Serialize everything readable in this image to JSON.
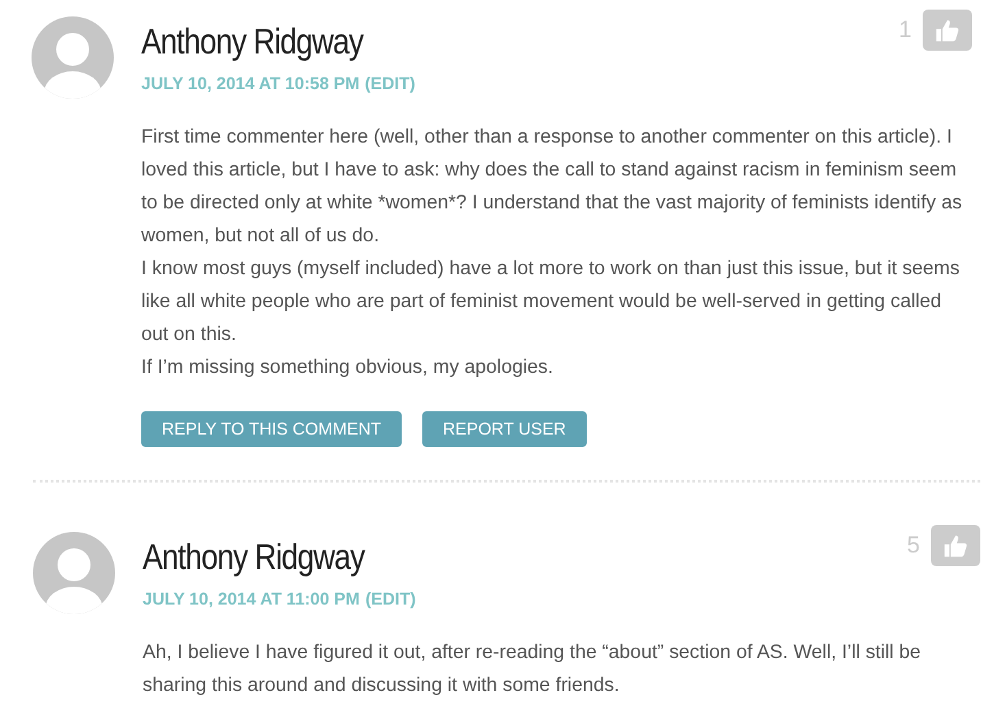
{
  "comments": [
    {
      "author": "Anthony Ridgway",
      "date": "JULY 10, 2014 AT 10:58 PM",
      "edit": "(EDIT)",
      "votes": "1",
      "paragraphs": [
        "First time commenter here (well, other than a response to another commenter on this article). I loved this article, but I have to ask: why does the call to stand against racism in feminism seem to be directed only at white *women*? I understand that the vast majority of feminists identify as women, but not all of us do.",
        "I know most guys (myself included) have a lot more to work on than just this issue, but it seems like all white people who are part of feminist movement would be well-served in getting called out on this.",
        "If I’m missing something obvious, my apologies."
      ],
      "buttons": [
        "REPLY TO THIS COMMENT",
        "REPORT USER"
      ],
      "children": [
        {
          "author": "Anthony Ridgway",
          "date": "JULY 10, 2014 AT 11:00 PM",
          "edit": "(EDIT)",
          "votes": "5",
          "paragraphs": [
            "Ah, I believe I have figured it out, after re-reading the “about” section of AS. Well, I’ll still be sharing this around and discussing it with some friends."
          ]
        }
      ]
    }
  ]
}
